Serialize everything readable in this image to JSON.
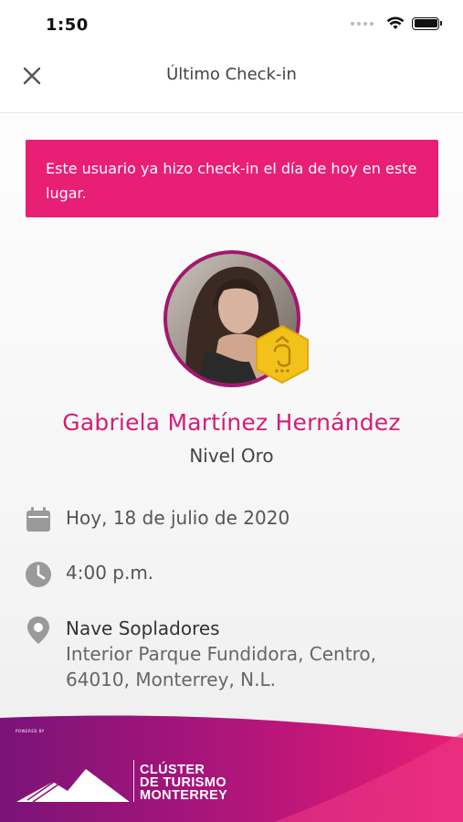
{
  "status_bar": {
    "time": "1:50"
  },
  "header": {
    "title": "Último Check-in"
  },
  "alert": {
    "message": "Este usuario ya hizo check-in el día de hoy en este lugar."
  },
  "user": {
    "name": "Gabriela Martínez Hernández",
    "level": "Nivel Oro"
  },
  "checkin": {
    "date": "Hoy, 18 de julio de 2020",
    "time": "4:00 p.m.",
    "location_name": "Nave Sopladores",
    "location_address": "Interior Parque Fundidora, Centro, 64010, Monterrey, N.L."
  },
  "footer": {
    "powered_by": "POWERED BY",
    "brand_line1": "CLÚSTER",
    "brand_line2": "DE TURISMO",
    "brand_line3": "MONTERREY"
  },
  "colors": {
    "accent": "#e91e75",
    "name": "#d81b77",
    "avatar_ring": "#a4176d",
    "badge": "#f2c21b",
    "icon": "#9a9a9a"
  },
  "icons": [
    "close-icon",
    "wifi-icon",
    "battery-icon",
    "calendar-icon",
    "clock-icon",
    "location-pin-icon",
    "gold-badge-icon"
  ]
}
